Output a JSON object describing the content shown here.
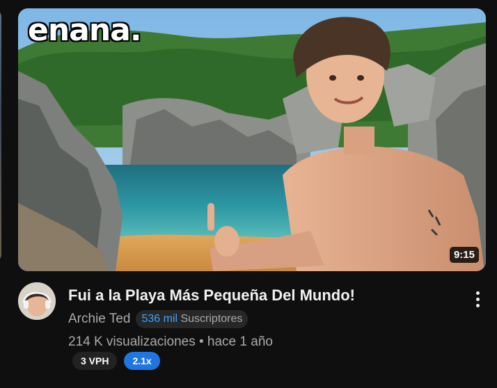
{
  "video": {
    "thumbnail_text": "enana.",
    "duration": "9:15",
    "title": "Fui a la Playa Más Pequeña Del Mundo!",
    "channel": "Archie Ted",
    "subscribers_count": "536 mil",
    "subscribers_label": "Suscriptores",
    "stats": "214 K visualizaciones • hace 1 año",
    "badges": {
      "vph": "3 VPH",
      "multiplier": "2.1x"
    }
  },
  "icons": {
    "more": "more-vert-icon"
  },
  "colors": {
    "background": "#0f0f0f",
    "link_blue": "#3ea6ff",
    "multiplier_badge": "#1f76e0"
  }
}
